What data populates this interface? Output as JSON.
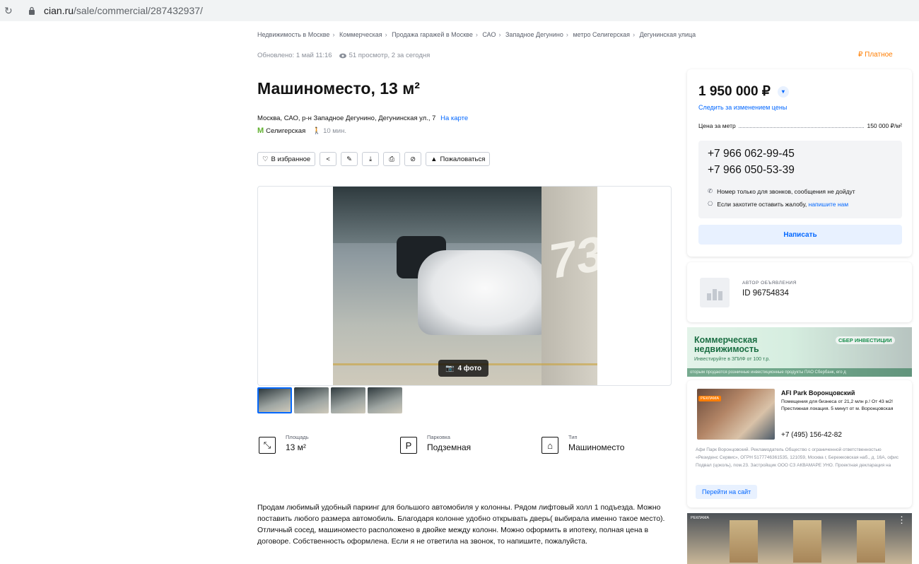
{
  "browser": {
    "url_domain": "cian.ru",
    "url_path": "/sale/commercial/287432937/"
  },
  "breadcrumb": [
    "Недвижимость в Москве",
    "Коммерческая",
    "Продажа гаражей в Москве",
    "САО",
    "Западное Дегунино",
    "метро Селигерская",
    "Дегунинская улица"
  ],
  "meta": {
    "updated": "Обновлено: 1 май 11:16",
    "views": "51 просмотр, 2 за сегодня",
    "paid_label": "₽ Платное"
  },
  "listing": {
    "title": "Машиноместо, 13 м²",
    "address": "Москва, САО, р-н Западное Дегунино, Дегунинская ул., 7",
    "map_link": "На карте",
    "metro_icon": "М",
    "metro": "Селигерская",
    "walk": "10 мин."
  },
  "actions": {
    "favorite": "В избранное",
    "complain": "Пожаловаться"
  },
  "gallery": {
    "photo_count": "4 фото",
    "thumbs": 4,
    "active_thumb": 0
  },
  "specs": [
    {
      "icon": "area-icon",
      "label": "Площадь",
      "value": "13 м²"
    },
    {
      "icon": "parking-icon",
      "label": "Парковка",
      "value": "Подземная"
    },
    {
      "icon": "garage-icon",
      "label": "Тип",
      "value": "Машиноместо"
    }
  ],
  "description": "Продам любимый удобный паркинг для большого автомобиля у колонны. Рядом лифтовый холл 1 подъезда. Можно поставить любого размера автомобиль. Благодаря колонне удобно открывать дверь( выбирала именно такое место). Отличный сосед, машиноместо расположено в двойке между колонн. Можно оформить в ипотеку, полная цена в договоре. Собственность оформлена. Если я не ответила на звонок, то напишите, пожалуйста.",
  "price_card": {
    "price": "1 950 000 ₽",
    "follow": "Следить за изменением цены",
    "ppm_label": "Цена за метр",
    "ppm_value": "150 000 ₽/м²",
    "phone1": "+7 966 062-99-45",
    "phone2": "+7 966 050-53-39",
    "note_calls": "Номер только для звонков, сообщения не дойдут",
    "note_complaint": "Если захотите оставить жалобу,",
    "note_link": "напишите нам",
    "write_button": "Написать"
  },
  "author": {
    "label": "АВТОР ОБЪЯВЛЕНИЯ",
    "id": "ID 96754834"
  },
  "banner_sber": {
    "line1": "Коммерческая",
    "line2": "недвижимость",
    "sub": "Инвестируйте в ЗПИФ от 100 т.р.",
    "brand": "СБЕР ИНВЕСТИЦИИ",
    "fine": "оторым продаются розничные инвестиционные продукты ПАО Сбербанк, его д"
  },
  "ad": {
    "tag": "РЕКЛАМА",
    "title": "AFI Park Воронцовский",
    "text": "Помещения для бизнеса от 21,2 млн р.! От 43 м2! Престижная локация. 5 минут от м. Воронцовская",
    "phone": "+7 (495) 156-42-82",
    "legal": "Афи Парк Воронцовский. Рекламодатель Общество с ограниченной ответственностью «Резиденс Сервис», ОГРН 5177746361535, 121059, Москва г, Бережковская наб., д. 16А, офис Подвал (цоколь), пом.23. Застройщик ООО СЗ АКВАМАРЕ УНО. Проектная декларация на",
    "button": "Перейти на сайт"
  },
  "banner_bottom": {
    "tag": "РЕКЛАМА"
  }
}
